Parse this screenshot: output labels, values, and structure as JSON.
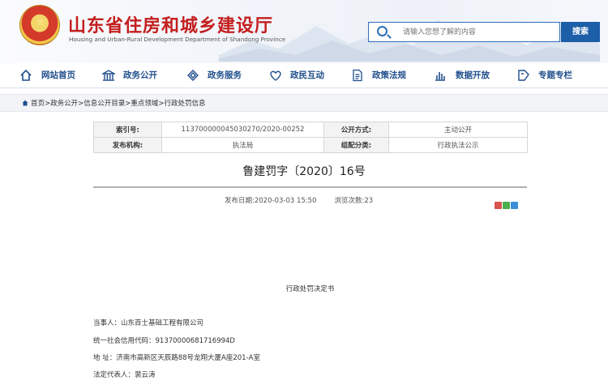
{
  "header": {
    "site_title": "山东省住房和城乡建设厅",
    "site_subtitle": "Housing and Urban-Rural Development Department of Shandong Province",
    "search_placeholder": "请输入您想了解的内容",
    "search_button": "搜索"
  },
  "nav": {
    "items": [
      {
        "label": "网站首页",
        "icon": "home-icon"
      },
      {
        "label": "政务公开",
        "icon": "government-building-icon"
      },
      {
        "label": "政务服务",
        "icon": "service-diamond-icon"
      },
      {
        "label": "政民互动",
        "icon": "interaction-heart-icon"
      },
      {
        "label": "政策法规",
        "icon": "document-icon"
      },
      {
        "label": "数据开放",
        "icon": "bar-chart-icon"
      },
      {
        "label": "专题专栏",
        "icon": "topics-icon"
      }
    ]
  },
  "breadcrumb": {
    "text": "首页>政务公开>信息公开目录>重点领域>行政处罚信息"
  },
  "info_table": {
    "index_label": "索引号:",
    "index_value": "113700000045030270/2020-00252",
    "disclosure_label": "公开方式:",
    "disclosure_value": "主动公开",
    "publisher_label": "发布机构:",
    "publisher_value": "执法局",
    "category_label": "组配分类:",
    "category_value": "行政执法公示"
  },
  "document": {
    "title": "鲁建罚字〔2020〕16号",
    "publish_date": "发布日期:2020-03-03 15:50",
    "views": "浏览次数:23",
    "body_heading": "行政处罚决定书",
    "paragraphs": [
      "当事人：山东百士基础工程有限公司",
      "统一社会信用代码：91370000681716994D",
      "地  址：济南市高新区天辰路88号龙翔大厦A座201-A室",
      "法定代表人：裴云涛"
    ]
  },
  "colors": {
    "title_red": "#c41e1e",
    "nav_blue": "#1f4e8c",
    "search_blue": "#1d5ea8"
  }
}
